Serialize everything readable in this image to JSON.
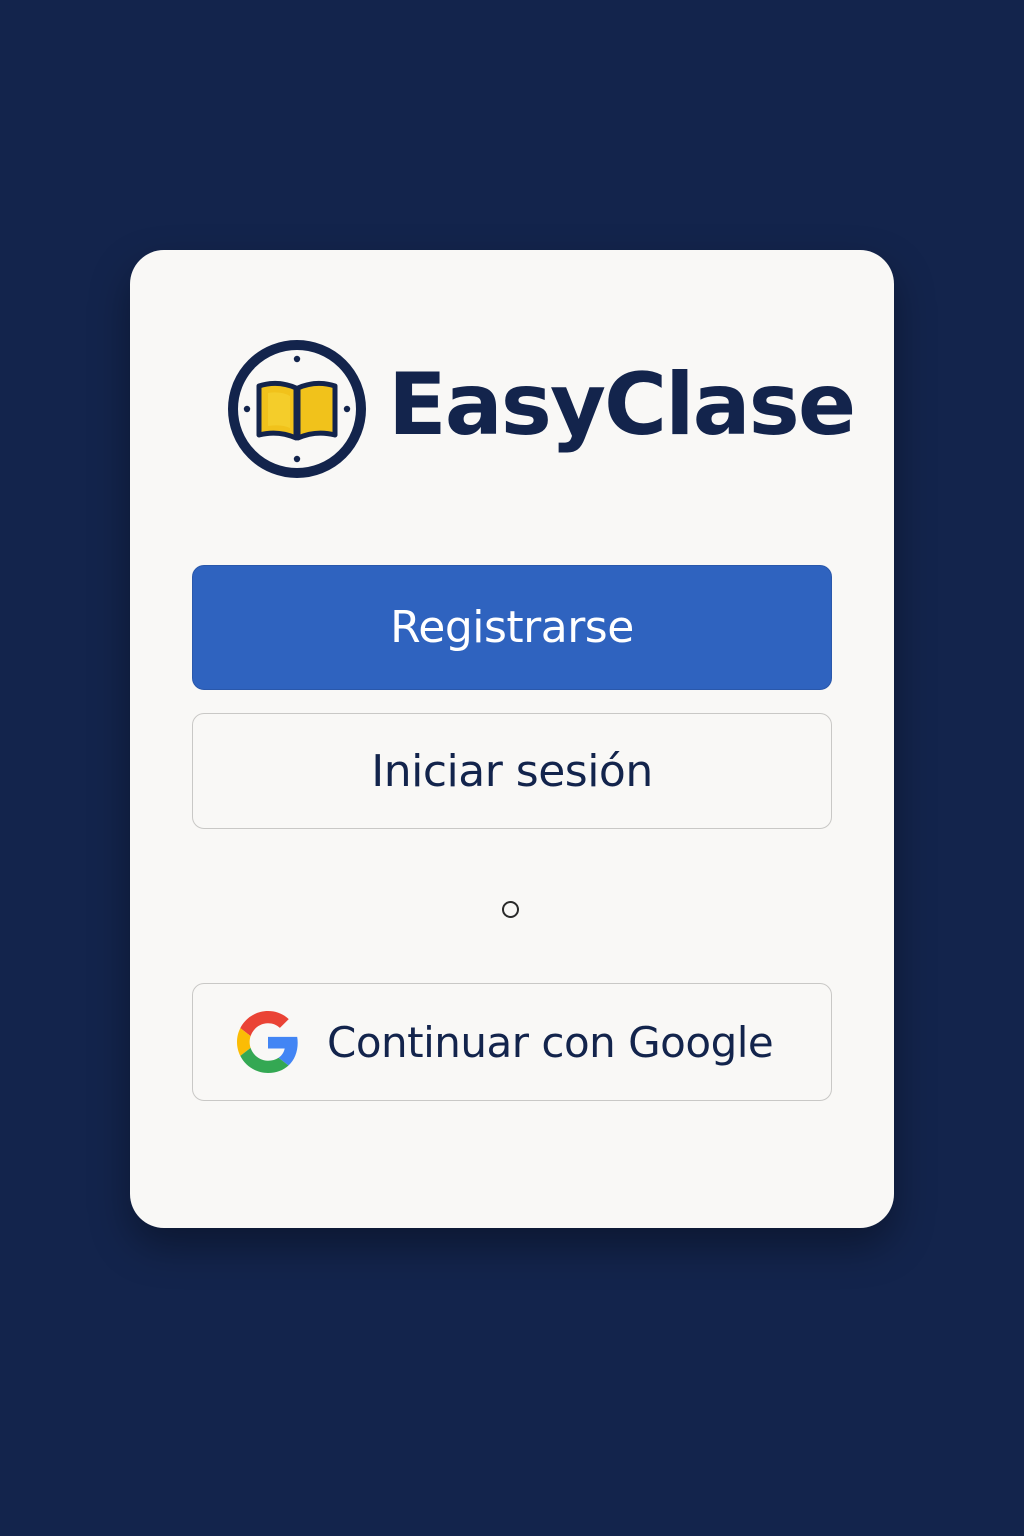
{
  "app": {
    "name": "EasyClase"
  },
  "logo": {
    "icon": "open-book-compass-icon",
    "ring_color": "#13244c",
    "book_color": "#f1c21b"
  },
  "actions": {
    "register_label": "Registrarse",
    "login_label": "Iniciar sesión",
    "separator": "o",
    "google_label": "Continuar con Google",
    "google_icon": "google-g-icon"
  },
  "colors": {
    "background": "#13244c",
    "card": "#f9f8f6",
    "primary": "#2f63bf",
    "text": "#13244c"
  }
}
